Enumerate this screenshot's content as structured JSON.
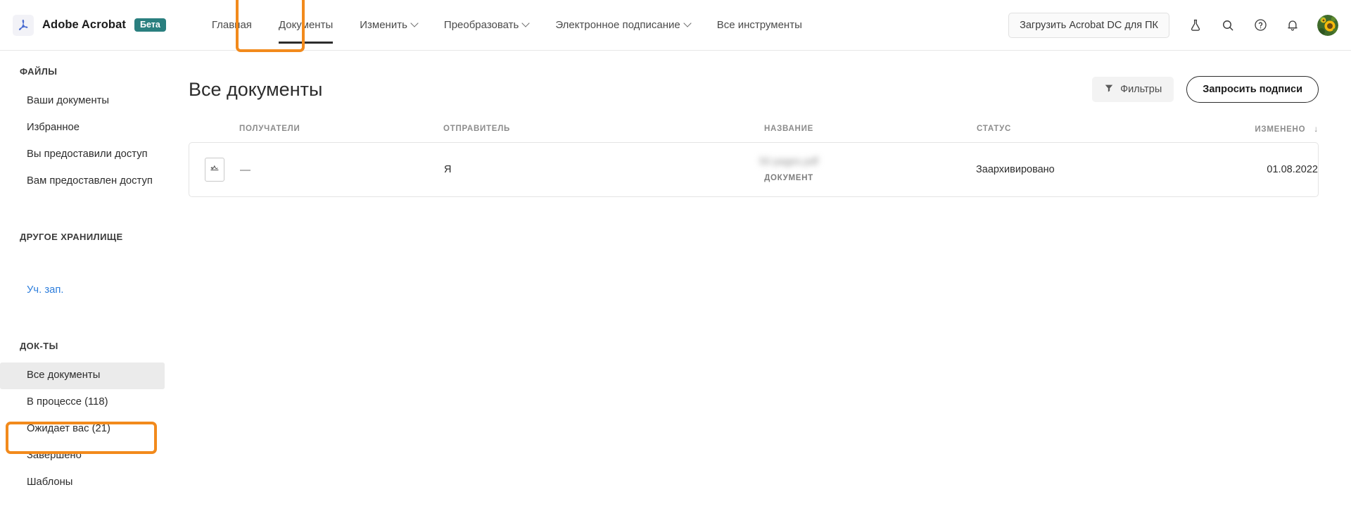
{
  "header": {
    "brand_name": "Adobe Acrobat",
    "beta_label": "Бета",
    "logo_icon": "acrobat-logo-icon",
    "nav": [
      {
        "label": "Главная",
        "has_caret": false,
        "active": false
      },
      {
        "label": "Документы",
        "has_caret": false,
        "active": true
      },
      {
        "label": "Изменить",
        "has_caret": true,
        "active": false
      },
      {
        "label": "Преобразовать",
        "has_caret": true,
        "active": false
      },
      {
        "label": "Электронное подписание",
        "has_caret": true,
        "active": false
      },
      {
        "label": "Все инструменты",
        "has_caret": false,
        "active": false
      }
    ],
    "download_button": "Загрузить Acrobat DC для ПК",
    "icons": [
      "beaker-icon",
      "search-icon",
      "help-icon",
      "bell-icon"
    ],
    "avatar": "sunflower-avatar"
  },
  "sidebar": {
    "files_title": "ФАЙЛЫ",
    "files_items": [
      {
        "label": "Ваши документы"
      },
      {
        "label": "Избранное"
      },
      {
        "label": "Вы предоставили доступ"
      },
      {
        "label": "Вам предоставлен доступ"
      }
    ],
    "storage_title": "ДРУГОЕ ХРАНИЛИЩЕ",
    "storage_items": [
      {
        "label": "Уч. зап."
      }
    ],
    "docs_title": "ДОК-ТЫ",
    "docs_items": [
      {
        "label": "Все документы",
        "selected": true
      },
      {
        "label": "В процессе (118)",
        "selected": false
      },
      {
        "label": "Ожидает вас (21)",
        "selected": false
      },
      {
        "label": "Завершено",
        "selected": false
      },
      {
        "label": "Шаблоны",
        "selected": false
      }
    ]
  },
  "main": {
    "page_title": "Все документы",
    "filters_button": "Фильтры",
    "filters_icon": "funnel-icon",
    "request_button": "Запросить подписи",
    "table": {
      "columns": [
        {
          "key": "recipients",
          "label": "ПОЛУЧАТЕЛИ"
        },
        {
          "key": "sender",
          "label": "ОТПРАВИТЕЛЬ"
        },
        {
          "key": "name",
          "label": "НАЗВАНИЕ"
        },
        {
          "key": "status",
          "label": "СТАТУС"
        },
        {
          "key": "modified",
          "label": "ИЗМЕНЕНО"
        }
      ],
      "sort_column": "ИЗМЕНЕНО",
      "sort_arrow": "↓",
      "rows": [
        {
          "icon": "signed-document-icon",
          "recipients": "—",
          "sender": "Я",
          "name": "50 pages.pdf",
          "name_kind": "ДОКУМЕНТ",
          "status": "Заархивировано",
          "modified": "01.08.2022"
        }
      ]
    }
  },
  "annotations": {
    "documents_tab_highlight": "orange-box-documents-tab",
    "all_documents_highlight": "orange-box-all-documents",
    "color": "#f28a1c"
  }
}
